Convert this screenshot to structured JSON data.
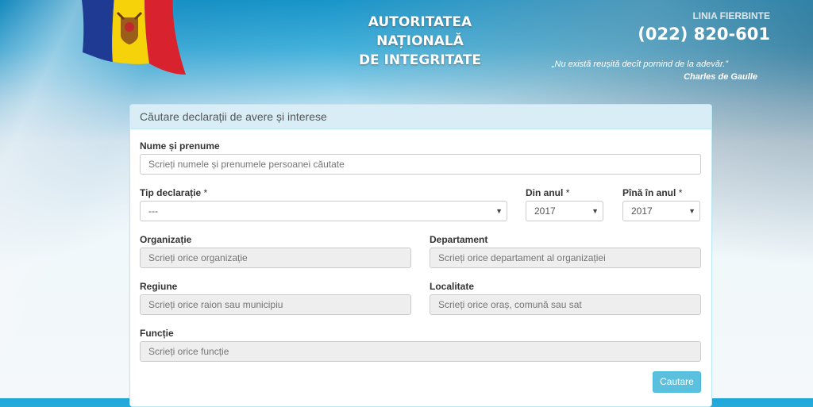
{
  "header": {
    "agency_title_lines": [
      "AUTORITATEA",
      "NAȚIONALĂ",
      "DE INTEGRITATE"
    ],
    "hotline_label": "LINIA FIERBINTE",
    "hotline_number": "(022) 820-601",
    "quote": "„Nu există reușită decît pornind de la adevăr.”",
    "quote_author": "Charles de Gaulle"
  },
  "form": {
    "title": "Căutare declarații de avere și interese",
    "name": {
      "label": "Nume și prenume",
      "placeholder": "Scrieți numele și prenumele persoanei căutate"
    },
    "declaration_type": {
      "label": "Tip declarație",
      "required_mark": "*",
      "value": "---"
    },
    "year_from": {
      "label": "Din anul",
      "required_mark": "*",
      "value": "2017"
    },
    "year_to": {
      "label": "Pînă în anul",
      "required_mark": "*",
      "value": "2017"
    },
    "organization": {
      "label": "Organizație",
      "placeholder": "Scrieți orice organizație"
    },
    "department": {
      "label": "Departament",
      "placeholder": "Scrieți orice departament al organizației"
    },
    "region": {
      "label": "Regiune",
      "placeholder": "Scrieți orice raion sau municipiu"
    },
    "locality": {
      "label": "Localitate",
      "placeholder": "Scrieți orice oraș, comună sau sat"
    },
    "function": {
      "label": "Funcție",
      "placeholder": "Scrieți orice funcție"
    },
    "submit_label": "Cautare"
  },
  "colors": {
    "panel_heading_bg": "#d9edf7",
    "button": "#5bc0de",
    "disabled_field": "#eeeeee"
  }
}
